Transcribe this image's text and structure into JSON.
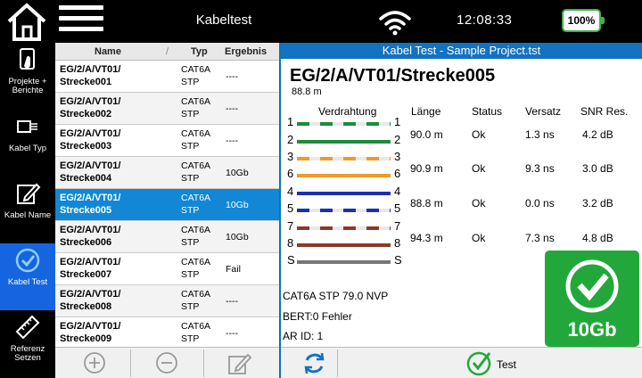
{
  "header": {
    "app_title": "Kabeltest",
    "time": "12:08:33",
    "battery": "100%"
  },
  "sidebar": {
    "items": [
      {
        "label": "Projekte + Berichte",
        "icon": "projects-icon"
      },
      {
        "label": "Kabel Typ",
        "icon": "cable-type-icon"
      },
      {
        "label": "Kabel Name",
        "icon": "edit-icon"
      },
      {
        "label": "Kabel Test",
        "icon": "check-circle-icon"
      },
      {
        "label": "Referenz Setzen",
        "icon": "ruler-icon"
      }
    ],
    "active_index": 3
  },
  "list": {
    "columns": {
      "name": "Name",
      "typ": "Typ",
      "ergebnis": "Ergebnis"
    },
    "rows": [
      {
        "name_line1": "EG/2/A/VT01/",
        "name_line2": "Strecke001",
        "typ_line1": "CAT6A",
        "typ_line2": "STP",
        "result": "----"
      },
      {
        "name_line1": "EG/2/A/VT01/",
        "name_line2": "Strecke002",
        "typ_line1": "CAT6A",
        "typ_line2": "STP",
        "result": "----"
      },
      {
        "name_line1": "EG/2/A/VT01/",
        "name_line2": "Strecke003",
        "typ_line1": "CAT6A",
        "typ_line2": "STP",
        "result": "----"
      },
      {
        "name_line1": "EG/2/A/VT01/",
        "name_line2": "Strecke004",
        "typ_line1": "CAT6A",
        "typ_line2": "STP",
        "result": "10Gb"
      },
      {
        "name_line1": "EG/2/A/VT01/",
        "name_line2": "Strecke005",
        "typ_line1": "CAT6A",
        "typ_line2": "STP",
        "result": "10Gb"
      },
      {
        "name_line1": "EG/2/A/VT01/",
        "name_line2": "Strecke006",
        "typ_line1": "CAT6A",
        "typ_line2": "STP",
        "result": "10Gb"
      },
      {
        "name_line1": "EG/2/A/VT01/",
        "name_line2": "Strecke007",
        "typ_line1": "CAT6A",
        "typ_line2": "STP",
        "result": "Fail"
      },
      {
        "name_line1": "EG/2/A/VT01/",
        "name_line2": "Strecke008",
        "typ_line1": "CAT6A",
        "typ_line2": "STP",
        "result": "----"
      },
      {
        "name_line1": "EG/2/A/VT01/",
        "name_line2": "Strecke009",
        "typ_line1": "CAT6A",
        "typ_line2": "STP",
        "result": "----"
      }
    ],
    "selected_index": 4
  },
  "detail": {
    "panel_title": "Kabel Test - Sample Project.tst",
    "cable_name": "EG/2/A/VT01/Strecke005",
    "cable_length": "88.8 m",
    "columns": {
      "wiring": "Verdrahtung",
      "length": "Länge",
      "status": "Status",
      "delay": "Versatz",
      "snr": "SNR Res."
    },
    "pins": [
      {
        "left": "1",
        "right": "1",
        "color": "#1f8a3c",
        "striped": true
      },
      {
        "left": "2",
        "right": "2",
        "color": "#1f8a3c",
        "striped": false
      },
      {
        "left": "3",
        "right": "3",
        "color": "#f09a2a",
        "striped": true
      },
      {
        "left": "6",
        "right": "6",
        "color": "#f09a2a",
        "striped": false
      },
      {
        "left": "4",
        "right": "4",
        "color": "#1c2fb5",
        "striped": false
      },
      {
        "left": "5",
        "right": "5",
        "color": "#1c2fb5",
        "striped": true
      },
      {
        "left": "7",
        "right": "7",
        "color": "#8a3a2a",
        "striped": true
      },
      {
        "left": "8",
        "right": "8",
        "color": "#8a3a2a",
        "striped": false
      },
      {
        "left": "S",
        "right": "S",
        "color": "#777777",
        "striped": false
      }
    ],
    "pairs": [
      {
        "length": "90.0 m",
        "status": "Ok",
        "delay": "1.3 ns",
        "snr": "4.2 dB"
      },
      {
        "length": "90.9 m",
        "status": "Ok",
        "delay": "9.3 ns",
        "snr": "3.0 dB"
      },
      {
        "length": "88.8 m",
        "status": "Ok",
        "delay": "0.0 ns",
        "snr": "3.2 dB"
      },
      {
        "length": "94.3 m",
        "status": "Ok",
        "delay": "7.3 ns",
        "snr": "4.8 dB"
      }
    ],
    "info": {
      "cable_spec": "CAT6A STP  79.0 NVP",
      "bert": "BERT:0 Fehler",
      "ar_id": "AR ID: 1"
    },
    "result_badge": "10Gb",
    "test_button": "Test"
  },
  "colors": {
    "accent_blue": "#1372c2",
    "selected_row": "#1187d6",
    "sidebar_active": "#1565e0",
    "pass_green": "#22a83a"
  }
}
